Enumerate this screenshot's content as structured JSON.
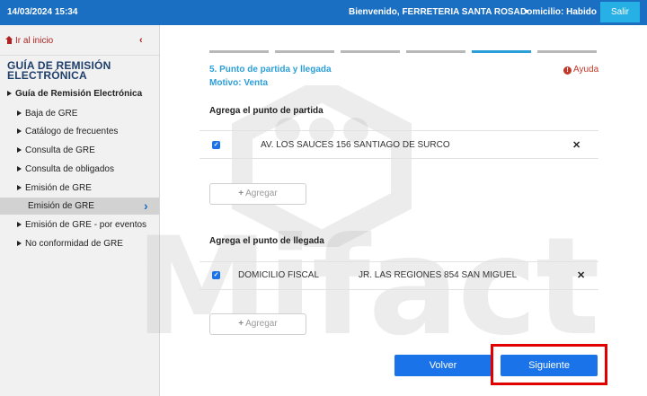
{
  "header": {
    "datetime": "14/03/2024 15:34",
    "welcome": "Bienvenido, FERRETERIA SANTA ROSA",
    "domicilio": "Domicilio: Habido",
    "logout_label": "Salir"
  },
  "sidebar": {
    "home_label": "Ir al inicio",
    "collapse_glyph": "‹",
    "title": "GUÍA DE REMISIÓN ELECTRÓNICA",
    "root_label": "Guía de Remisión Electrónica",
    "items": [
      "Baja de GRE",
      "Catálogo de frecuentes",
      "Consulta de GRE",
      "Consulta de obligados",
      "Emisión de GRE",
      "Emisión de GRE",
      "Emisión de GRE - por eventos",
      "No conformidad de GRE"
    ],
    "active_chevron": "›"
  },
  "watermark": "Mifact",
  "steps": {
    "count": 6,
    "active_index": 4,
    "active_color": "#2b9fd8",
    "inactive_color": "#b8b8b8"
  },
  "form": {
    "step_title": "5. Punto de partida y llegada",
    "motivo": "Motivo: Venta",
    "help_label": "Ayuda",
    "partida": {
      "section_label": "Agrega el punto de partida",
      "address": "AV. LOS SAUCES 156 SANTIAGO DE SURCO",
      "add_label": "Agregar"
    },
    "llegada": {
      "section_label": "Agrega el punto de llegada",
      "type": "DOMICILIO FISCAL",
      "address": "JR. LAS REGIONES 854 SAN MIGUEL",
      "add_label": "Agregar"
    },
    "check_glyph": "✓",
    "remove_glyph": "✕",
    "back_label": "Volver",
    "next_label": "Siguiente"
  },
  "colors": {
    "topbar": "#1a6fc2",
    "primary": "#1a73e8",
    "accent": "#2b9fd8",
    "highlight": "#e00000"
  }
}
